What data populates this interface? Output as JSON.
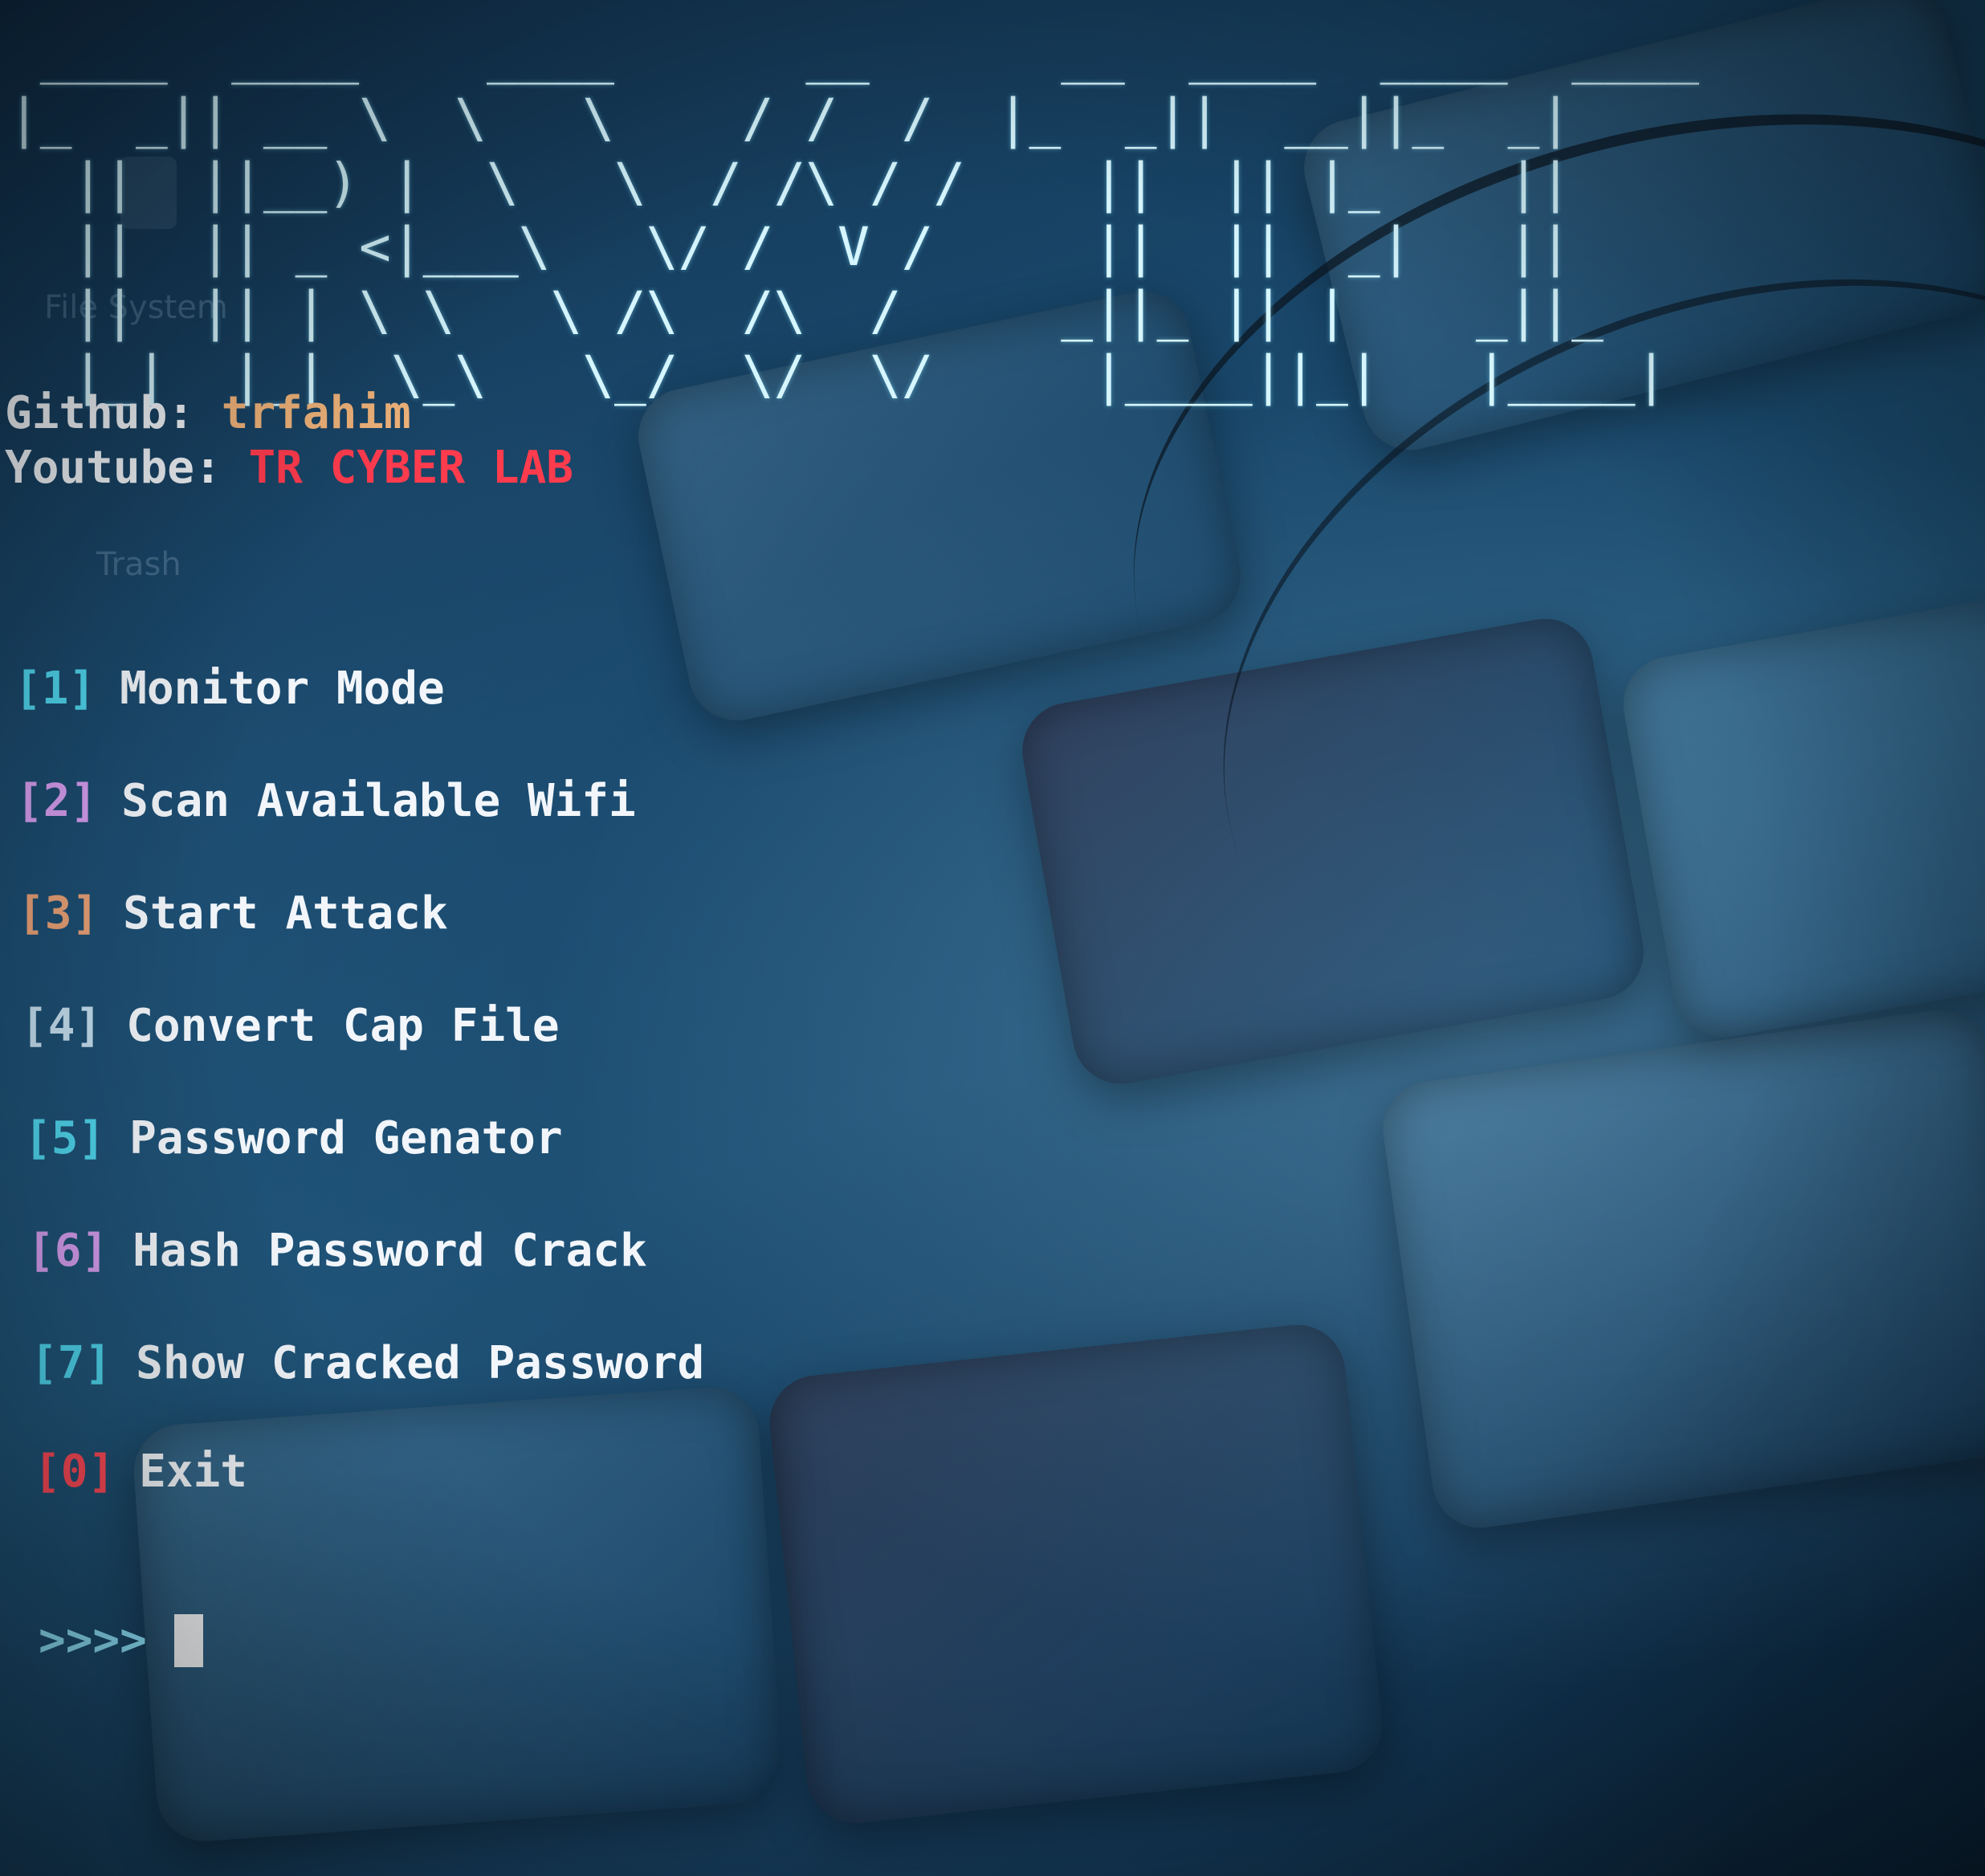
{
  "banner": {
    "ascii_art": " ____  ____    ____      __      __  ____  ____  ____\n|_  _|| __ \\  \\   \\    / /  /  |_  _||  __||_  _|\n  ||  ||__) |  \\   \\  / /\\ / /    ||  || |_    || \n  ||  || _ <|___\\   \\/ /  V /     ||  ||  _|   || \n  ||  || | \\ \\   \\ /\\  /\\  /     _||_ || |    _||_\n  |_|  |_|  \\_\\   \\_/  \\/  \\/     |____||_|   |____|",
    "logo_text": "TR-WIFI"
  },
  "info": {
    "github_label": "Github:",
    "github_value": "trfahim",
    "youtube_label": "Youtube:",
    "youtube_value": "TR CYBER LAB"
  },
  "menu": [
    {
      "num": "[1]",
      "label": "Monitor Mode",
      "color": "#4fd6ee"
    },
    {
      "num": "[2]",
      "label": "Scan Available Wifi",
      "color": "#d79ef0"
    },
    {
      "num": "[3]",
      "label": "Start Attack",
      "color": "#e9a277"
    },
    {
      "num": "[4]",
      "label": "Convert Cap File",
      "color": "#c5dff0"
    },
    {
      "num": "[5]",
      "label": "Password Genator",
      "color": "#4fd6ee"
    },
    {
      "num": "[6]",
      "label": "Hash Password Crack",
      "color": "#d79ef0"
    },
    {
      "num": "[7]",
      "label": "Show Cracked Password",
      "color": "#4fd6ee"
    },
    {
      "num": "[0]",
      "label": "Exit",
      "color": "#ff4a58"
    }
  ],
  "prompt": {
    "symbol": ">>>>",
    "input_value": ""
  },
  "desktop_ghost": {
    "file_system_label": "File System",
    "trash_label": "Trash"
  },
  "colors": {
    "banner": "#d6f6ff",
    "github_value": "#f0b37a",
    "youtube_value": "#ff3b4e",
    "text": "#f2f6fa"
  }
}
